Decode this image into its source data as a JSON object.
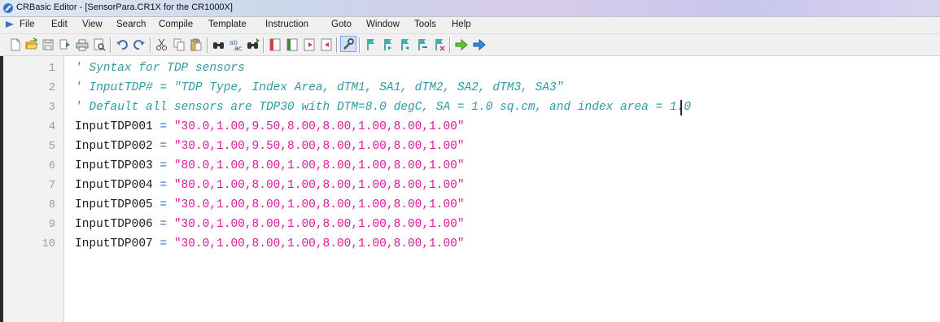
{
  "window": {
    "title": "CRBasic Editor - [SensorPara.CR1X for the CR1000X]"
  },
  "menu": [
    "File",
    "Edit",
    "View",
    "Search",
    "Compile",
    "Template",
    "Instruction",
    "Goto",
    "Window",
    "Tools",
    "Help"
  ],
  "toolbar": {
    "buttons": [
      "new-icon",
      "open-icon",
      "save-icon",
      "compile-icon",
      "print-icon",
      "print-preview-icon",
      "undo-icon",
      "redo-icon",
      "cut-icon",
      "copy-icon",
      "paste-icon",
      "find-icon",
      "replace-icon",
      "find-next-icon",
      "bookmark-icon",
      "bookmark-toggle-icon",
      "next-bookmark-icon",
      "prev-bookmark-icon",
      "wrench-icon",
      "flag-icon",
      "flag-green-icon",
      "flag-blue-icon",
      "flag-next-icon",
      "flag-clear-icon",
      "arrow-right-green-icon",
      "arrow-right-blue-icon"
    ]
  },
  "editor": {
    "lines": [
      {
        "num": "1",
        "comment": "' Syntax for TDP sensors"
      },
      {
        "num": "2",
        "comment": "' InputTDP# = \"TDP Type, Index Area, dTM1, SA1, dTM2, SA2, dTM3, SA3\""
      },
      {
        "num": "3",
        "comment": "' Default all sensors are TDP30 with DTM=8.0 degC, SA = 1.0 sq.cm, and index area = 1.0"
      },
      {
        "num": "4",
        "ident": "InputTDP001",
        "op": " = ",
        "str": "\"30.0,1.00,9.50,8.00,8.00,1.00,8.00,1.00\""
      },
      {
        "num": "5",
        "ident": "InputTDP002",
        "op": " = ",
        "str": "\"30.0,1.00,9.50,8.00,8.00,1.00,8.00,1.00\""
      },
      {
        "num": "6",
        "ident": "InputTDP003",
        "op": " = ",
        "str": "\"80.0,1.00,8.00,1.00,8.00,1.00,8.00,1.00\""
      },
      {
        "num": "7",
        "ident": "InputTDP004",
        "op": " = ",
        "str": "\"80.0,1.00,8.00,1.00,8.00,1.00,8.00,1.00\""
      },
      {
        "num": "8",
        "ident": "InputTDP005",
        "op": " = ",
        "str": "\"30.0,1.00,8.00,1.00,8.00,1.00,8.00,1.00\""
      },
      {
        "num": "9",
        "ident": "InputTDP006",
        "op": " = ",
        "str": "\"30.0,1.00,8.00,1.00,8.00,1.00,8.00,1.00\""
      },
      {
        "num": "10",
        "ident": "InputTDP007",
        "op": " = ",
        "str": "\"30.0,1.00,8.00,1.00,8.00,1.00,8.00,1.00\""
      }
    ]
  },
  "colors": {
    "comment": "#2f9aa6",
    "string": "#e0199a",
    "operator": "#3a6fb0",
    "gutter": "#f2f2f2"
  }
}
